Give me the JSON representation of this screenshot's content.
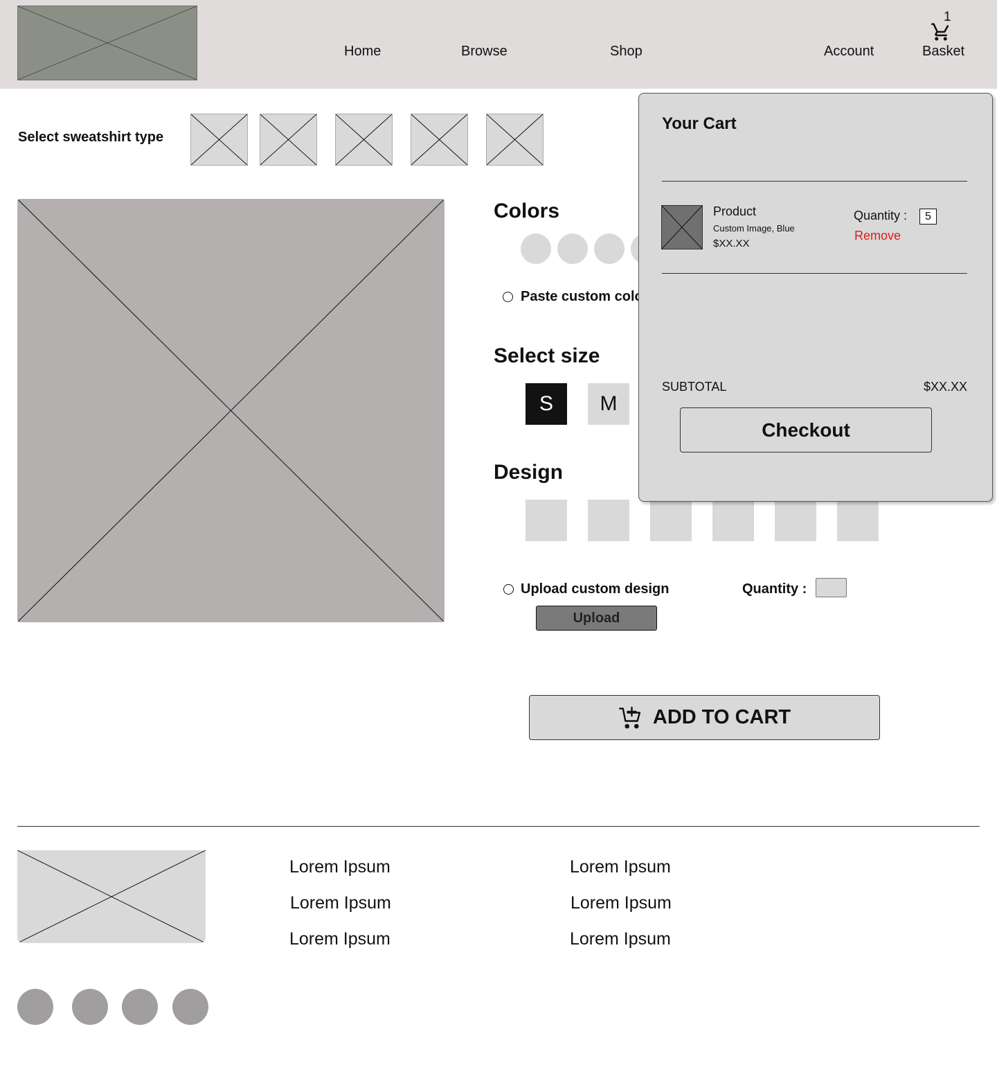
{
  "header": {
    "nav": [
      "Home",
      "Browse",
      "Shop",
      "Account",
      "Basket"
    ],
    "cart_count": "1",
    "icons": {
      "logo": "image-placeholder",
      "basket": "cart-icon"
    }
  },
  "product": {
    "type_label": "Select sweatshirt type",
    "type_count": 5,
    "colors_heading": "Colors",
    "paste_color_label": "Paste custom color",
    "size_heading": "Select size",
    "sizes": [
      "S",
      "M"
    ],
    "selected_size": "S",
    "design_heading": "Design",
    "upload_label": "Upload custom design",
    "upload_button": "Upload",
    "quantity_label": "Quantity :",
    "quantity_value": "",
    "add_to_cart": "ADD TO CART"
  },
  "cart": {
    "title": "Your Cart",
    "item": {
      "name": "Product",
      "options": "Custom Image, Blue",
      "price": "$XX.XX",
      "quantity_label": "Quantity :",
      "quantity": "5",
      "remove": "Remove"
    },
    "subtotal_label": "SUBTOTAL",
    "subtotal": "$XX.XX",
    "checkout": "Checkout"
  },
  "footer": {
    "col1": [
      "Lorem Ipsum",
      "Lorem Ipsum",
      "Lorem Ipsum"
    ],
    "col2": [
      "Lorem Ipsum",
      "Lorem Ipsum",
      "Lorem Ipsum"
    ],
    "social_icons": [
      "social-icon",
      "social-icon",
      "social-icon",
      "social-icon"
    ]
  },
  "colors": {
    "header_bg": "#dfdcdb",
    "logo_bg": "#8b8f86",
    "remove_red": "#e21a1a",
    "selected_size_bg": "#121212",
    "placeholder": "#d9d9d9"
  }
}
